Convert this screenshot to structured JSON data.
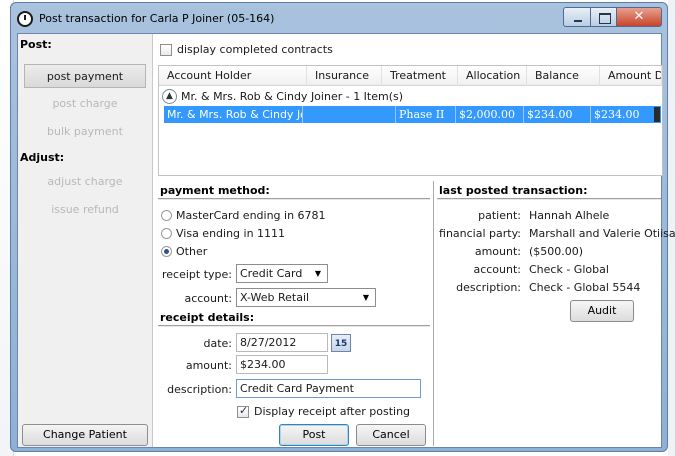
{
  "window": {
    "title": "Post transaction for Carla P Joiner (05-164)"
  },
  "nav": {
    "post_heading": "Post:",
    "adjust_heading": "Adjust:",
    "items": [
      {
        "label": "post payment"
      },
      {
        "label": "post charge"
      },
      {
        "label": "bulk payment"
      },
      {
        "label": "adjust charge"
      },
      {
        "label": "issue refund"
      }
    ],
    "change_patient": "Change Patient"
  },
  "contracts": {
    "show_completed_label": "display completed contracts",
    "columns": [
      "Account Holder",
      "Insurance",
      "Treatment",
      "Allocation",
      "Balance",
      "Amount Due"
    ],
    "group_label": "Mr. & Mrs. Rob & Cindy Joiner - 1 Item(s)",
    "selected_row": {
      "account_holder": "Mr. & Mrs. Rob & Cindy Joi",
      "insurance": "",
      "treatment": "Phase II",
      "allocation": "$2,000.00",
      "balance": "$234.00",
      "amount_due": "$234.00"
    }
  },
  "payment_method": {
    "title": "payment method:",
    "options": [
      "MasterCard ending in 6781",
      "Visa ending in 1111",
      "Other"
    ],
    "selected": "Other",
    "receipt_type_label": "receipt type:",
    "receipt_type_value": "Credit Card",
    "account_label": "account:",
    "account_value": "X-Web Retail"
  },
  "receipt_details": {
    "title": "receipt details:",
    "date_label": "date:",
    "date_value": "8/27/2012",
    "calendar_day": "15",
    "amount_label": "amount:",
    "amount_value": "$234.00",
    "description_label": "description:",
    "description_value": "Credit Card Payment",
    "display_receipt_label": "Display receipt after posting",
    "post_button": "Post",
    "cancel_button": "Cancel"
  },
  "last_posted": {
    "title": "last posted transaction:",
    "fields": [
      {
        "label": "patient:",
        "value": "Hannah Alhele"
      },
      {
        "label": "financial party:",
        "value": "Marshall and Valerie Otiisang"
      },
      {
        "label": "amount:",
        "value": "($500.00)"
      },
      {
        "label": "account:",
        "value": "Check - Global"
      },
      {
        "label": "description:",
        "value": "Check - Global 5544"
      }
    ],
    "audit_button": "Audit"
  }
}
